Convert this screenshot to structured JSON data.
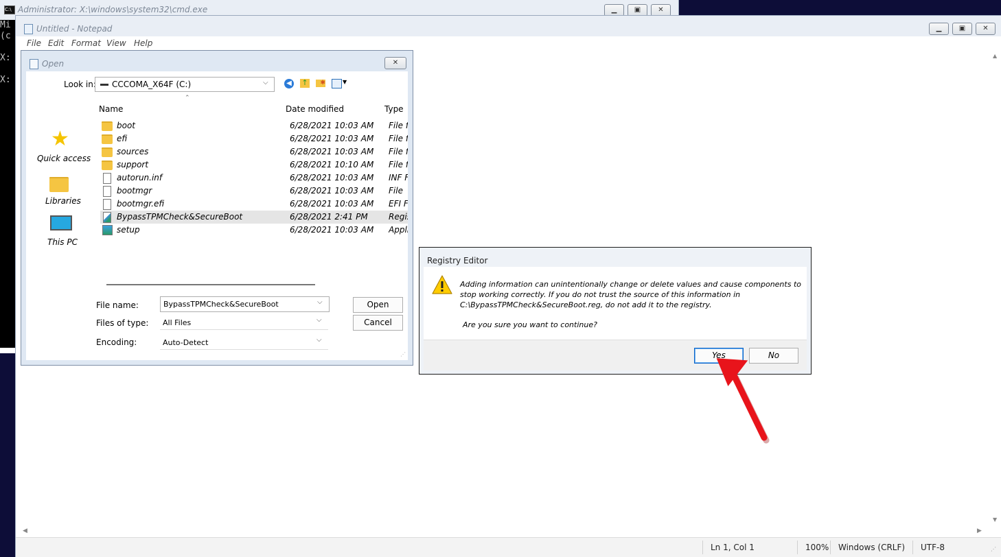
{
  "cmd": {
    "title": "Administrator: X:\\windows\\system32\\cmd.exe",
    "console_lines": [
      "Mi",
      "(c",
      "",
      "X:",
      "",
      "X:"
    ]
  },
  "notepad": {
    "title": "Untitled - Notepad",
    "menu": [
      "File",
      "Edit",
      "Format",
      "View",
      "Help"
    ],
    "status": {
      "position": "Ln 1, Col 1",
      "zoom": "100%",
      "line_ending": "Windows (CRLF)",
      "encoding": "UTF-8"
    }
  },
  "open_dialog": {
    "title": "Open",
    "look_in_label": "Look in:",
    "look_in_value": "CCCOMA_X64F (C:)",
    "places": [
      "Quick access",
      "Libraries",
      "This PC"
    ],
    "columns": {
      "name": "Name",
      "date": "Date modified",
      "type": "Type"
    },
    "files": [
      {
        "name": "boot",
        "date": "6/28/2021 10:03 AM",
        "type": "File fo",
        "icon": "folder"
      },
      {
        "name": "efi",
        "date": "6/28/2021 10:03 AM",
        "type": "File fo",
        "icon": "folder"
      },
      {
        "name": "sources",
        "date": "6/28/2021 10:03 AM",
        "type": "File fo",
        "icon": "folder"
      },
      {
        "name": "support",
        "date": "6/28/2021 10:10 AM",
        "type": "File fo",
        "icon": "folder"
      },
      {
        "name": "autorun.inf",
        "date": "6/28/2021 10:03 AM",
        "type": "INF Fi",
        "icon": "file"
      },
      {
        "name": "bootmgr",
        "date": "6/28/2021 10:03 AM",
        "type": "File",
        "icon": "file"
      },
      {
        "name": "bootmgr.efi",
        "date": "6/28/2021 10:03 AM",
        "type": "EFI Fi",
        "icon": "file"
      },
      {
        "name": "BypassTPMCheck&SecureBoot",
        "date": "6/28/2021 2:41 PM",
        "type": "Regis",
        "icon": "registry-file",
        "selected": true
      },
      {
        "name": "setup",
        "date": "6/28/2021 10:03 AM",
        "type": "Appli",
        "icon": "setup"
      }
    ],
    "file_name_label": "File name:",
    "file_name_value": "BypassTPMCheck&SecureBoot",
    "file_type_label": "Files of type:",
    "file_type_value": "All Files",
    "encoding_label": "Encoding:",
    "encoding_value": "Auto-Detect",
    "open_button": "Open",
    "cancel_button": "Cancel"
  },
  "registry_dialog": {
    "title": "Registry Editor",
    "message_lines": [
      "Adding information can unintentionally change or delete values and cause components to",
      "stop working correctly. If you do not trust the source of this information in",
      "C:\\BypassTPMCheck&SecureBoot.reg, do not add it to the registry."
    ],
    "question": "Are you sure you want to continue?",
    "yes_button": "Yes",
    "no_button": "No"
  },
  "colors": {
    "desktop": "#0d0d38",
    "selection": "#e5e5e5",
    "arrow": "#e8141b",
    "warning": "#ffcc00"
  }
}
